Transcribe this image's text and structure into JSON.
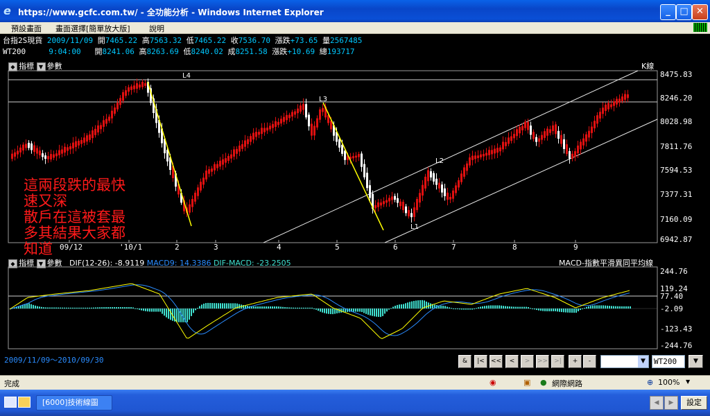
{
  "window": {
    "title": "https://www.gcfc.com.tw/ - 全功能分析 - Windows Internet Explorer",
    "minimize": "_",
    "maximize": "□",
    "close": "✕"
  },
  "menu": [
    "預設畫面",
    "畫面選擇[簡單放大版]",
    "說明"
  ],
  "quotes": [
    {
      "symbol": "台指2S現貨",
      "time": "2009/11/09",
      "open_label": "開",
      "open": "7465.22",
      "high_label": "高",
      "high": "7563.32",
      "low_label": "低",
      "low": "7465.22",
      "close_label": "收",
      "close": "7536.70",
      "chg_label": "漲跌",
      "chg": "+73.65",
      "vol_label": "量",
      "vol": "2567485"
    },
    {
      "symbol": "WT200",
      "time": "9:04:00",
      "open_label": "開",
      "open": "8241.06",
      "high_label": "高",
      "high": "8263.69",
      "low_label": "低",
      "low": "8240.02",
      "close_label": "成",
      "close": "8251.58",
      "chg_label": "漲跌",
      "chg": "+10.69",
      "vol_label": "總",
      "vol": "193717"
    }
  ],
  "kpanel": {
    "indicator_btn": "指標",
    "param_btn": "參數",
    "title": "K線",
    "yticks": [
      "8475.83",
      "8246.20",
      "8028.98",
      "7811.76",
      "7594.53",
      "7377.31",
      "7160.09",
      "6942.87"
    ],
    "xticks": [
      "09/12",
      "'10/1",
      "2",
      "3",
      "4",
      "5",
      "6",
      "7",
      "8",
      "9"
    ],
    "labels": {
      "L4": "L4",
      "L3": "L3",
      "L2": "L2",
      "L1": "L1"
    },
    "annotation": [
      "這兩段跌的最快",
      "速又深",
      "散戶在這被套最",
      "多其結果大家都",
      "知道"
    ]
  },
  "macd": {
    "indicator_btn": "指標",
    "param_btn": "參數",
    "dif_label": "DIF(12-26):",
    "dif": "-8.9119",
    "macd_label": "MACD9:",
    "macd": "14.3386",
    "diff_label": "DIF-MACD:",
    "diff": "-23.2505",
    "title": "MACD-指數平滑異同平均線",
    "yticks": [
      "244.76",
      "119.24",
      "77.40",
      "-2.09",
      "-123.43",
      "-244.76"
    ]
  },
  "toolbar": {
    "range": "2009/11/09～2010/09/30",
    "buttons": [
      "&",
      "|<",
      "<<",
      "<",
      ">",
      ">>",
      ">|",
      "+",
      "-"
    ],
    "select_value": "",
    "symbol_value": "WT200",
    "go": "▼"
  },
  "status": {
    "text": "完成",
    "zone": "網際網路",
    "zoom": "100%"
  },
  "taskbar": {
    "task": "[6000]技術線圖",
    "settings": "設定"
  },
  "colors": {
    "up": "#e01010",
    "down": "#ffffff",
    "yellow": "#ffff00",
    "blue": "#2a8cff",
    "hist": "#40e0d0",
    "annotation": "#ff1a1a"
  }
}
